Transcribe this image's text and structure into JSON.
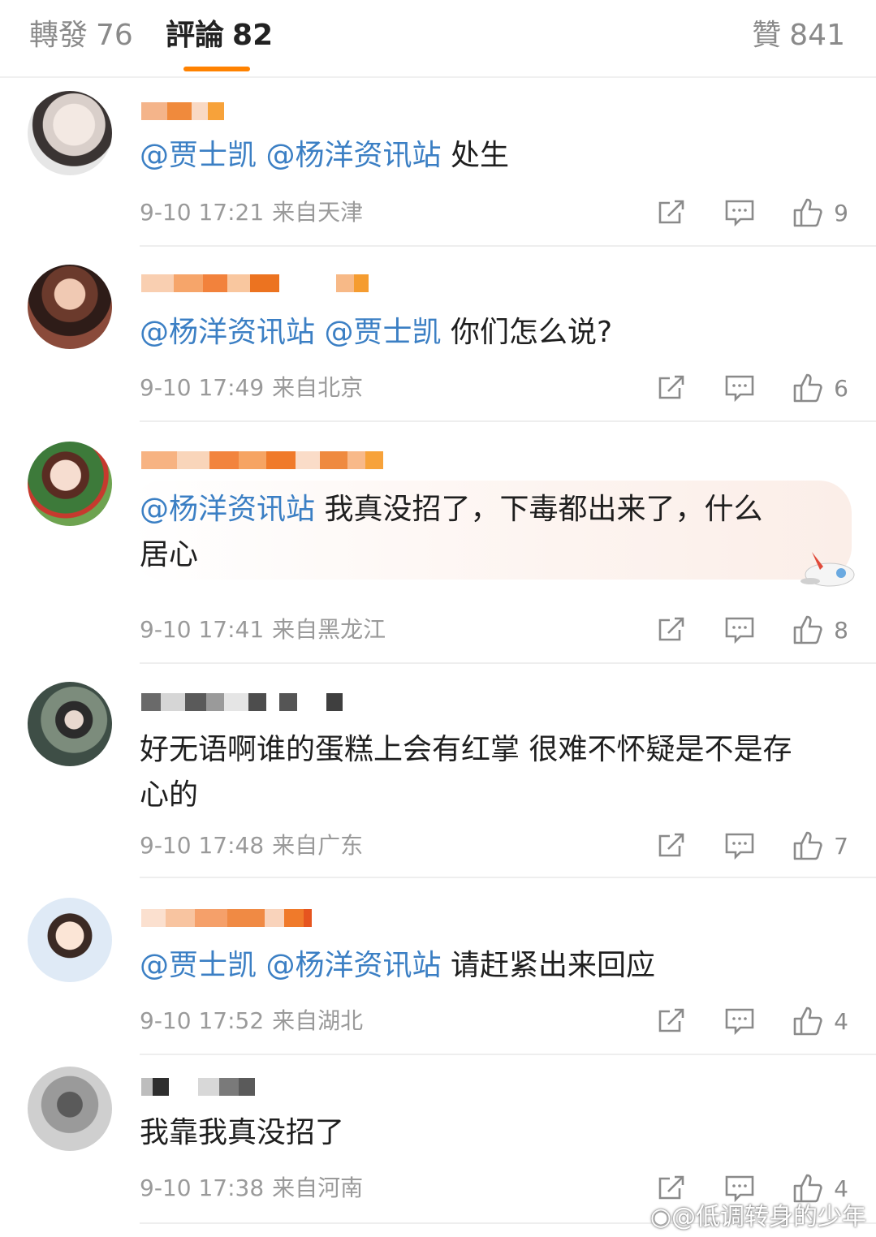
{
  "tabs": {
    "forward": {
      "label": "轉發",
      "count": "76"
    },
    "comments": {
      "label": "評論",
      "count": "82"
    },
    "likes": {
      "label": "贊",
      "count": "841"
    }
  },
  "comments": [
    {
      "mentions": [
        "@贾士凯",
        "@杨洋资讯站"
      ],
      "body": "处生",
      "date": "9-10 17:21",
      "location": "来自天津",
      "likes": "9"
    },
    {
      "mentions": [
        "@杨洋资讯站",
        "@贾士凯"
      ],
      "body": "你们怎么说?",
      "date": "9-10 17:49",
      "location": "来自北京",
      "likes": "6"
    },
    {
      "mentions": [
        "@杨洋资讯站"
      ],
      "body": "我真没招了，下毒都出来了，什么",
      "body2": "居心",
      "date": "9-10 17:41",
      "location": "来自黑龙江",
      "likes": "8"
    },
    {
      "mentions": [],
      "body": "好无语啊谁的蛋糕上会有红掌 很难不怀疑是不是存",
      "body2": "心的",
      "date": "9-10 17:48",
      "location": "来自广东",
      "likes": "7"
    },
    {
      "mentions": [
        "@贾士凯",
        "@杨洋资讯站"
      ],
      "body": "请赶紧出来回应",
      "date": "9-10 17:52",
      "location": "来自湖北",
      "likes": "4"
    },
    {
      "mentions": [],
      "body": "我靠我真没招了",
      "date": "9-10 17:38",
      "location": "来自河南",
      "likes": "4"
    }
  ],
  "watermark": "@低调转身的少年",
  "colors": {
    "accent": "#ff8200",
    "mention": "#3b7fc4",
    "meta": "#9a9a9a"
  },
  "icons": [
    "share-icon",
    "comment-icon",
    "thumbs-up-icon",
    "weibo-logo-icon"
  ]
}
